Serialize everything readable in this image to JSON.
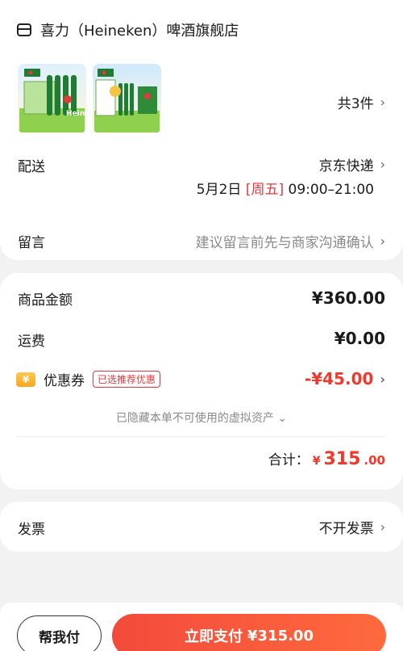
{
  "store": {
    "name": "喜力（Heineken）啤酒旗舰店",
    "icon": "store-icon",
    "item_count": "共3件"
  },
  "products": [
    {
      "name": "Heineken",
      "color": "#2e8b3a"
    },
    {
      "name": "Heineken",
      "color": "#2e8b3a"
    }
  ],
  "delivery": {
    "label": "配送",
    "carrier": "京东快递",
    "date": "5月2日",
    "weekday": "[周五]",
    "time": "09:00–21:00"
  },
  "note": {
    "label": "留言",
    "placeholder": "建议留言前先与商家沟通确认"
  },
  "amounts": {
    "goods_label": "商品金额",
    "goods_value": "¥360.00",
    "shipping_label": "运费",
    "shipping_value": "¥0.00",
    "coupon_icon_text": "¥",
    "coupon_label": "优惠券",
    "coupon_tag": "已选推荐优惠",
    "coupon_value": "-¥45.00",
    "hidden_assets": "已隐藏本单不可使用的虚拟资产 ⌄",
    "total_label": "合计：",
    "total_currency": "¥",
    "total_int": "315",
    "total_dec": ".00"
  },
  "invoice": {
    "label": "发票",
    "value": "不开发票"
  },
  "actions": {
    "help_pay": "帮我付",
    "pay_now": "立即支付",
    "pay_amount": "¥315.00"
  },
  "colors": {
    "accent_red": "#f0392b",
    "coupon_gold": "#f6a623"
  }
}
